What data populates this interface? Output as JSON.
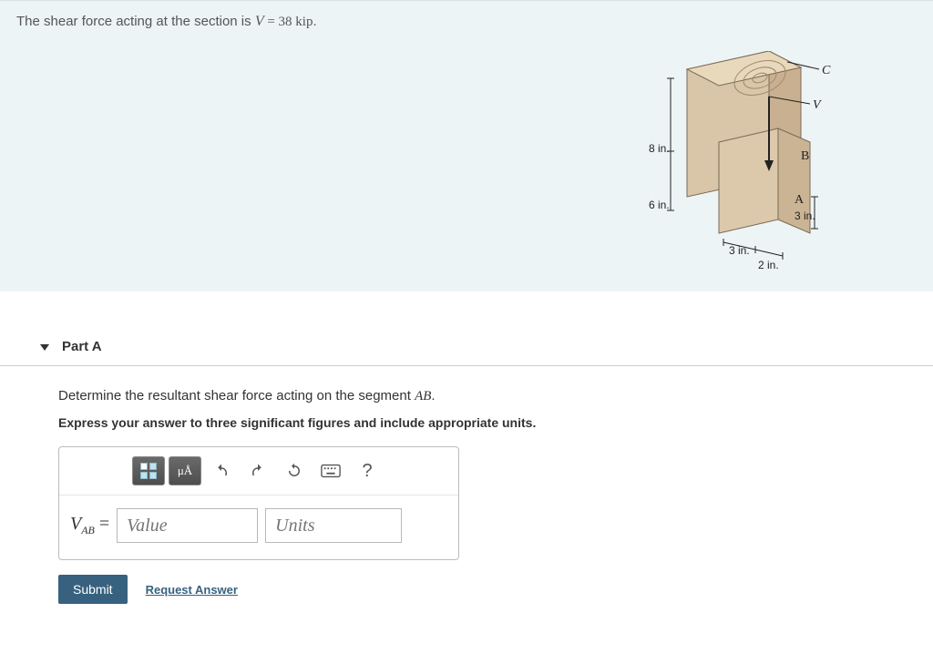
{
  "problem": {
    "text_prefix": "The shear force acting at the section is ",
    "formula_var": "V",
    "formula_eq": " = 38 kip",
    "formula_suffix": "."
  },
  "figure": {
    "labels": {
      "C": "C",
      "V": "V",
      "B": "B",
      "A": "A"
    },
    "dims": {
      "top": "8 in.",
      "mid": "6 in.",
      "right": "3 in.",
      "bot1": "3 in.",
      "bot2": "2 in."
    }
  },
  "part": {
    "title": "Part A",
    "question_prefix": "Determine the resultant shear force acting on the segment ",
    "question_var": "AB",
    "question_suffix": ".",
    "instruction": "Express your answer to three significant figures and include appropriate units."
  },
  "toolbar": {
    "templates_tip": "Templates",
    "symbols_label": "μÅ",
    "undo_tip": "Undo",
    "redo_tip": "Redo",
    "reset_tip": "Reset",
    "keyboard_tip": "Keyboard",
    "help_tip": "Help"
  },
  "input": {
    "var_html": "V",
    "var_sub": "AB",
    "eq": " = ",
    "value_placeholder": "Value",
    "units_placeholder": "Units"
  },
  "actions": {
    "submit": "Submit",
    "request": "Request Answer"
  }
}
